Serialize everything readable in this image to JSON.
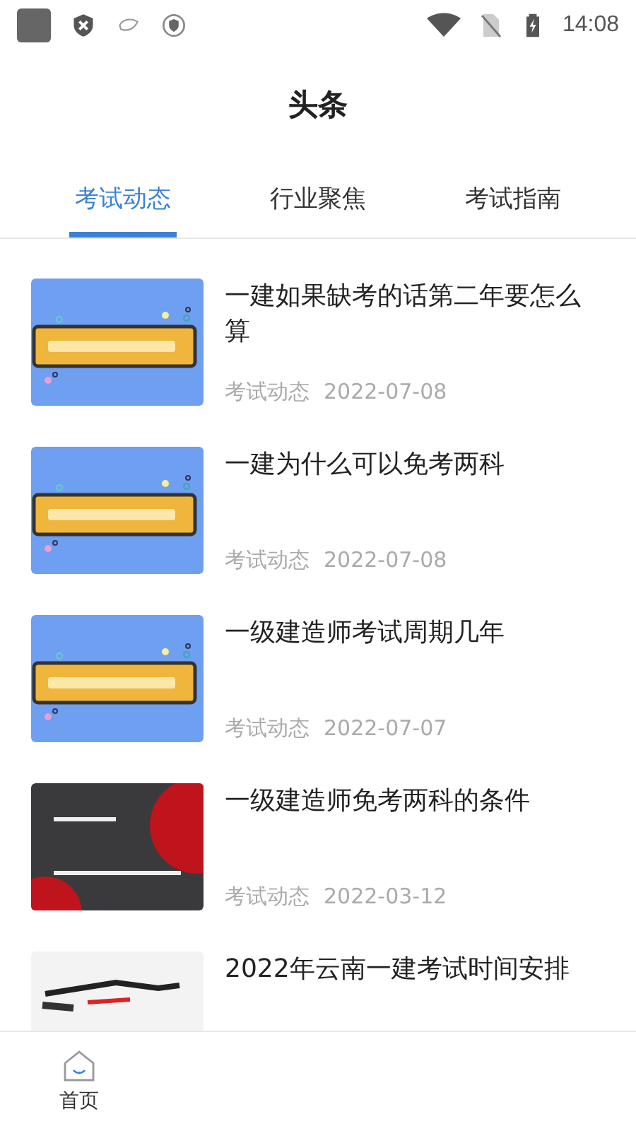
{
  "status_bar": {
    "time": "14:08"
  },
  "header": {
    "title": "头条"
  },
  "tabs": [
    {
      "label": "考试动态",
      "selected": true
    },
    {
      "label": "行业聚焦",
      "selected": false
    },
    {
      "label": "考试指南",
      "selected": false
    }
  ],
  "articles": [
    {
      "title": "一建如果缺考的话第二年要怎么算",
      "category": "考试动态",
      "date": "2022-07-08"
    },
    {
      "title": "一建为什么可以免考两科",
      "category": "考试动态",
      "date": "2022-07-08"
    },
    {
      "title": "一级建造师考试周期几年",
      "category": "考试动态",
      "date": "2022-07-07"
    },
    {
      "title": "一级建造师免考两科的条件",
      "category": "考试动态",
      "date": "2022-03-12"
    },
    {
      "title": "2022年云南一建考试时间安排"
    }
  ],
  "bottom_nav": [
    {
      "label": "首页",
      "selected": false
    }
  ]
}
